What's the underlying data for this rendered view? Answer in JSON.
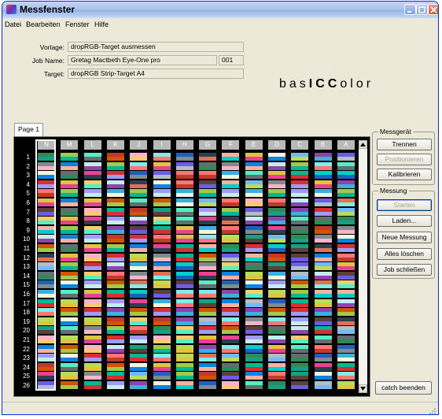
{
  "window": {
    "title": "Messfenster"
  },
  "menu": [
    "Datei",
    "Bearbeiten",
    "Fenster",
    "Hilfe"
  ],
  "info": {
    "vorlage_label": "Vorlage:",
    "vorlage_value": "dropRGB-Target ausmessen",
    "job_label": "Job Name:",
    "job_value": "Gretag Mactbeth Eye-One pro",
    "job_number": "001",
    "target_label": "Target:",
    "target_value": "dropRGB Strip-Target A4"
  },
  "logo": {
    "prefix": "bas",
    "bold": "ICC",
    "suffix": "olor"
  },
  "tabs": [
    "Page 1"
  ],
  "grid": {
    "columns": [
      "N",
      "M",
      "L",
      "K",
      "J",
      "I",
      "H",
      "G",
      "F",
      "E",
      "D",
      "C",
      "B",
      "A"
    ],
    "rows": [
      "1",
      "2",
      "3",
      "4",
      "5",
      "6",
      "7",
      "8",
      "9",
      "10",
      "11",
      "12",
      "13",
      "14",
      "15",
      "16",
      "17",
      "18",
      "19",
      "20",
      "21",
      "22",
      "23",
      "24",
      "25",
      "26"
    ],
    "selected_column": "N"
  },
  "messgeraet": {
    "title": "Messgerät",
    "trennen": "Trennen",
    "positionieren": "Positionieren",
    "kalibrieren": "Kalibrieren"
  },
  "messung": {
    "title": "Messung",
    "starten": "Starten",
    "laden": "Laden...",
    "neue_messung": "Neue Messung",
    "alles_loeschen": "Alles löschen",
    "job_schliessen": "Job schließen"
  },
  "catch_button": "catch beenden",
  "colors": {
    "titlebar": "#a9c4ef",
    "background": "#ece9d8",
    "grid_background": "#000000",
    "header_cell": "#b9b9b9"
  },
  "patch_palette": [
    "#2e8b57",
    "#c0392b",
    "#1f5fbf",
    "#e0c341",
    "#8e44ad",
    "#16a085",
    "#d35400",
    "#7f8c8d",
    "#e84393",
    "#3ab0e0",
    "#5d4037",
    "#a3c94a",
    "#ffb3c6",
    "#2c3e50",
    "#f5f5dc",
    "#6c5ce7",
    "#00b894",
    "#fdcb6e",
    "#e17055",
    "#0984e3",
    "#b2bec3",
    "#d63031",
    "#55efc4",
    "#81ecec",
    "#fab1a0",
    "#74b9ff",
    "#a29bfe",
    "#636e72",
    "#ff7675",
    "#00cec9",
    "#badc58",
    "#c7ecee"
  ]
}
